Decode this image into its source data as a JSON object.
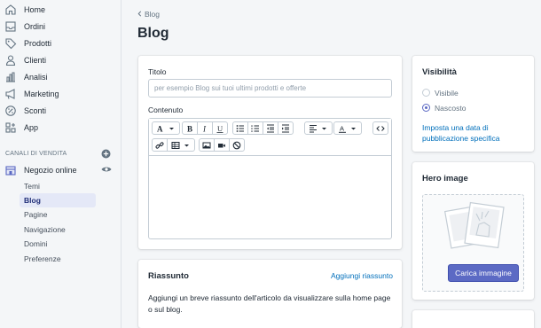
{
  "sidebar": {
    "items": [
      {
        "label": "Home",
        "icon": "home-icon"
      },
      {
        "label": "Ordini",
        "icon": "orders-icon"
      },
      {
        "label": "Prodotti",
        "icon": "tag-icon"
      },
      {
        "label": "Clienti",
        "icon": "customer-icon"
      },
      {
        "label": "Analisi",
        "icon": "analytics-icon"
      },
      {
        "label": "Marketing",
        "icon": "megaphone-icon"
      },
      {
        "label": "Sconti",
        "icon": "discount-icon"
      },
      {
        "label": "App",
        "icon": "apps-icon"
      }
    ],
    "channels_label": "CANALI DI VENDITA",
    "online_store": {
      "label": "Negozio online",
      "icon": "store-icon"
    },
    "sub_items": [
      {
        "label": "Temi",
        "active": false
      },
      {
        "label": "Blog",
        "active": true
      },
      {
        "label": "Pagine",
        "active": false
      },
      {
        "label": "Navigazione",
        "active": false
      },
      {
        "label": "Domini",
        "active": false
      },
      {
        "label": "Preferenze",
        "active": false
      }
    ]
  },
  "header": {
    "breadcrumb": "Blog",
    "title": "Blog"
  },
  "form": {
    "title_label": "Titolo",
    "title_placeholder": "per esempio Blog sui tuoi ultimi prodotti e offerte",
    "content_label": "Contenuto"
  },
  "summary": {
    "title": "Riassunto",
    "add_link": "Aggiungi riassunto",
    "text": "Aggiungi un breve riassunto dell'articolo da visualizzare sulla home page o sul blog."
  },
  "visibility": {
    "title": "Visibilità",
    "options": [
      {
        "label": "Visibile",
        "checked": false
      },
      {
        "label": "Nascosto",
        "checked": true
      }
    ],
    "schedule_link": "Imposta una data di pubblicazione specifica"
  },
  "hero": {
    "title": "Hero image",
    "upload_button": "Carica immagine"
  },
  "colors": {
    "accent": "#5c6ac4",
    "link": "#006fbb",
    "active_bg": "#e4e8f7"
  }
}
